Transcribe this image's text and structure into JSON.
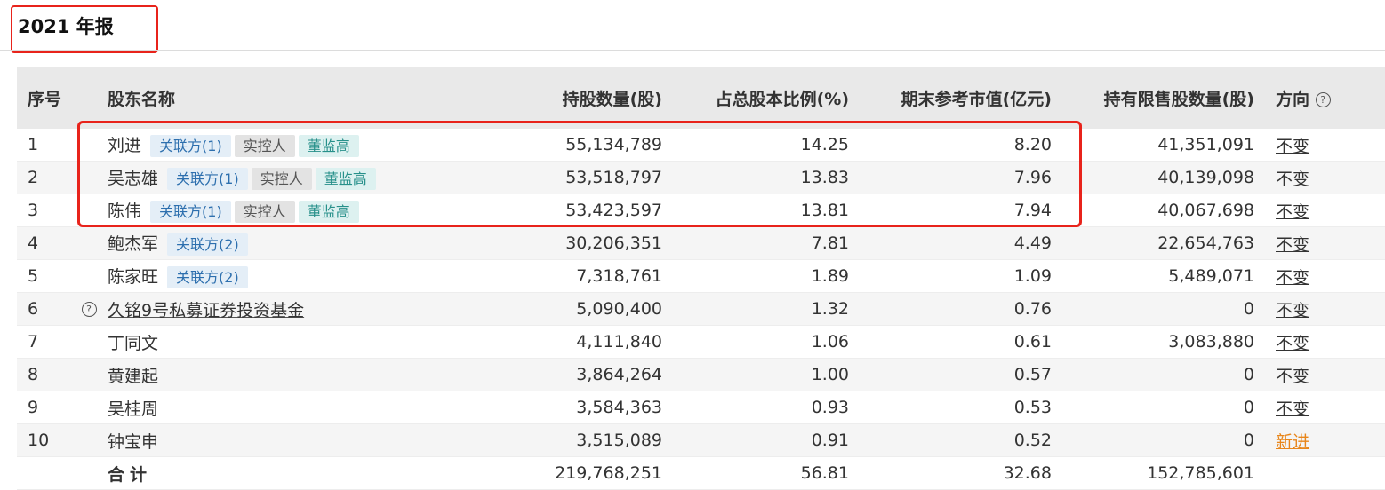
{
  "report_title": "2021 年报",
  "columns": {
    "index": "序号",
    "name": "股东名称",
    "shares": "持股数量(股)",
    "ratio": "占总股本比例(%)",
    "market_value": "期末参考市值(亿元)",
    "restricted": "持有限售股数量(股)",
    "direction": "方向"
  },
  "rows": [
    {
      "index": "1",
      "name": "刘进",
      "tags": [
        "关联方(1)",
        "实控人",
        "董监高"
      ],
      "shares": "55,134,789",
      "ratio": "14.25",
      "market_value": "8.20",
      "restricted": "41,351,091",
      "direction": "不变"
    },
    {
      "index": "2",
      "name": "吴志雄",
      "tags": [
        "关联方(1)",
        "实控人",
        "董监高"
      ],
      "shares": "53,518,797",
      "ratio": "13.83",
      "market_value": "7.96",
      "restricted": "40,139,098",
      "direction": "不变"
    },
    {
      "index": "3",
      "name": "陈伟",
      "tags": [
        "关联方(1)",
        "实控人",
        "董监高"
      ],
      "shares": "53,423,597",
      "ratio": "13.81",
      "market_value": "7.94",
      "restricted": "40,067,698",
      "direction": "不变"
    },
    {
      "index": "4",
      "name": "鲍杰军",
      "tags": [
        "关联方(2)"
      ],
      "shares": "30,206,351",
      "ratio": "7.81",
      "market_value": "4.49",
      "restricted": "22,654,763",
      "direction": "不变"
    },
    {
      "index": "5",
      "name": "陈家旺",
      "tags": [
        "关联方(2)"
      ],
      "shares": "7,318,761",
      "ratio": "1.89",
      "market_value": "1.09",
      "restricted": "5,489,071",
      "direction": "不变"
    },
    {
      "index": "6",
      "name": "久铭9号私募证券投资基金",
      "tags": [],
      "shares": "5,090,400",
      "ratio": "1.32",
      "market_value": "0.76",
      "restricted": "0",
      "direction": "不变"
    },
    {
      "index": "7",
      "name": "丁同文",
      "tags": [],
      "shares": "4,111,840",
      "ratio": "1.06",
      "market_value": "0.61",
      "restricted": "3,083,880",
      "direction": "不变"
    },
    {
      "index": "8",
      "name": "黄建起",
      "tags": [],
      "shares": "3,864,264",
      "ratio": "1.00",
      "market_value": "0.57",
      "restricted": "0",
      "direction": "不变"
    },
    {
      "index": "9",
      "name": "吴桂周",
      "tags": [],
      "shares": "3,584,363",
      "ratio": "0.93",
      "market_value": "0.53",
      "restricted": "0",
      "direction": "不变"
    },
    {
      "index": "10",
      "name": "钟宝申",
      "tags": [],
      "shares": "3,515,089",
      "ratio": "0.91",
      "market_value": "0.52",
      "restricted": "0",
      "direction": "新进"
    }
  ],
  "total": {
    "label": "合计",
    "shares": "219,768,251",
    "ratio": "56.81",
    "market_value": "32.68",
    "restricted": "152,785,601"
  },
  "icons": {
    "help": "question-circle-icon"
  },
  "colors": {
    "highlight": "#e8231b",
    "new_direction": "#e8861b",
    "tag_related": "#2d6fae",
    "tag_controller": "#555555",
    "tag_executive": "#27908a"
  }
}
